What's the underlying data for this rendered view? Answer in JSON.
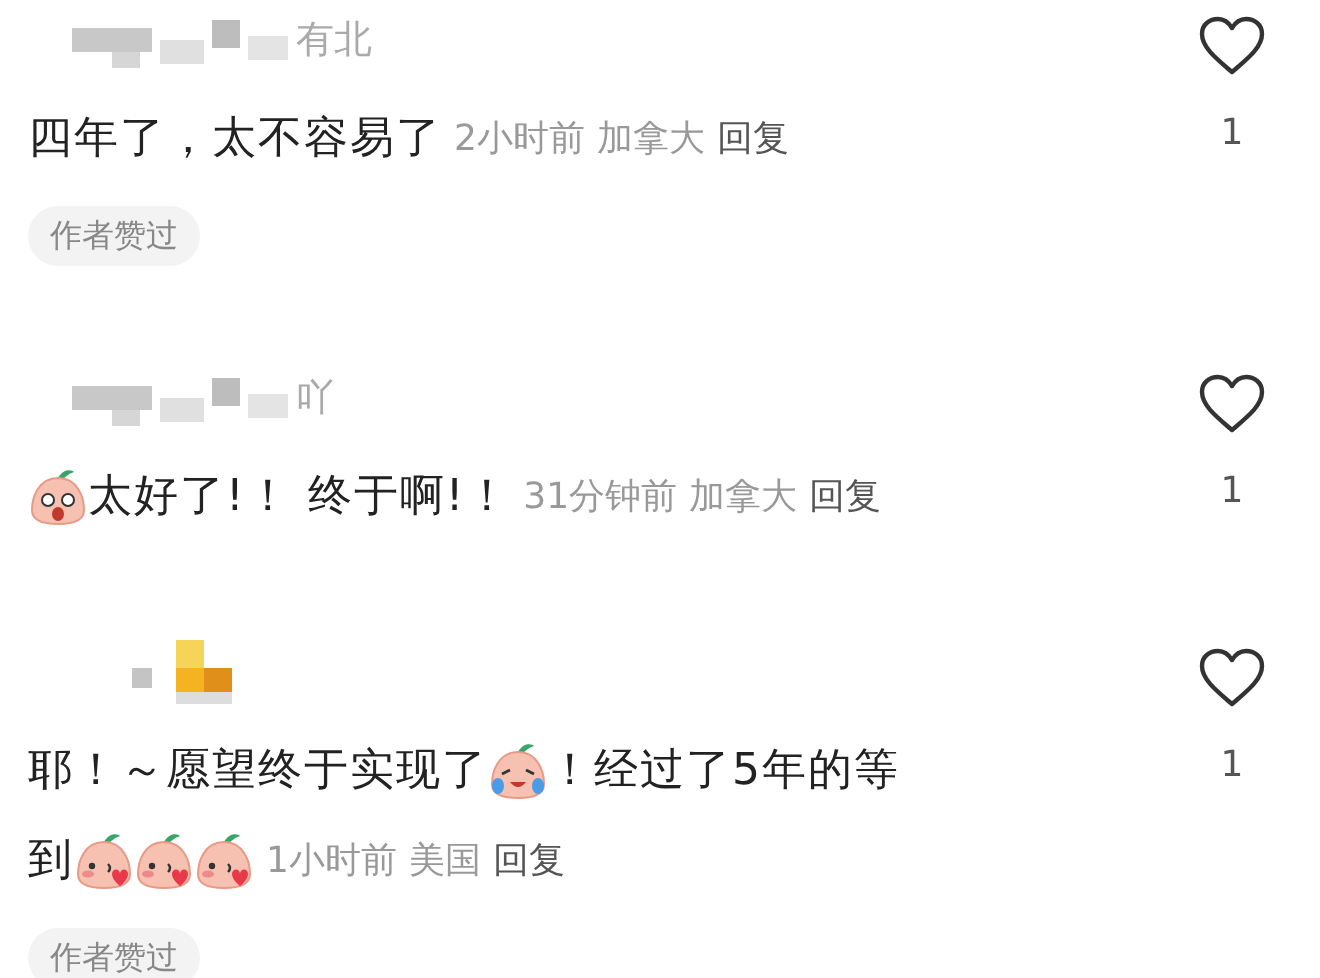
{
  "comments": [
    {
      "kind": "mosaic",
      "name_visible": "有北",
      "liked": false,
      "like_count": "1",
      "lines": [
        [
          {
            "kind": "text",
            "text": "四年了，太不容易了"
          }
        ]
      ],
      "time": "2小时前",
      "location": "加拿大",
      "reply": "回复",
      "badge": "作者赞过"
    },
    {
      "kind": "mosaic",
      "name_visible": "吖",
      "liked": false,
      "like_count": "1",
      "lines": [
        [
          {
            "kind": "surprised"
          },
          {
            "kind": "text",
            "text": "太好了!！ 终于啊!！"
          }
        ]
      ],
      "time": "31分钟前",
      "location": "加拿大",
      "reply": "回复"
    },
    {
      "kind": "tinted",
      "liked": false,
      "like_count": "1",
      "lines": [
        [
          {
            "kind": "text",
            "text": "耶！～愿望终于实现了"
          },
          {
            "kind": "crying"
          },
          {
            "kind": "text",
            "text": "！经过了5年的等"
          }
        ],
        [
          {
            "kind": "text",
            "text": "到"
          },
          {
            "kind": "blushing"
          },
          {
            "kind": "blushing"
          },
          {
            "kind": "blushing"
          }
        ]
      ],
      "time": "1小时前",
      "location": "美国",
      "reply": "回复",
      "badge": "作者赞过"
    }
  ]
}
